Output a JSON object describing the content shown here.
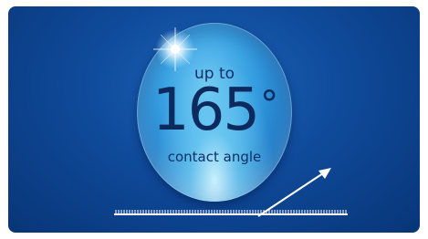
{
  "graphic": {
    "prefix": "up to",
    "value": "165",
    "unit": "°",
    "caption": "contact angle"
  },
  "icons": {
    "sparkle": "sparkle-icon",
    "surface": "textured-surface",
    "angle_arrow": "arrow-icon"
  },
  "colors": {
    "background": "#0f4a9a",
    "sphere": "#3aa3e3",
    "text": "#0c2a5e",
    "line": "#ffffff"
  }
}
